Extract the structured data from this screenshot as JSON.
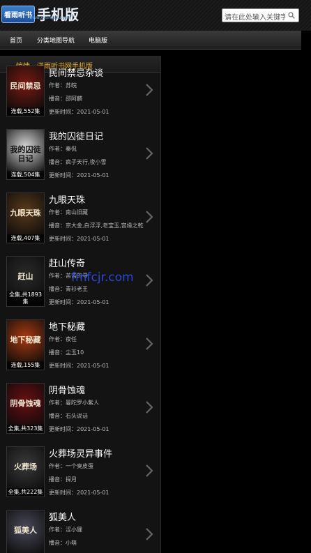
{
  "header": {
    "logo_badge": "看雨听书",
    "logo_title": "手机版",
    "logo_url": "www.xytingshu.com",
    "search_placeholder": "请在此处输入关键字"
  },
  "nav": [
    "首页",
    "分类地图导航",
    "电脑版"
  ],
  "panel": {
    "title": "惊悚 - 潇雨听书网手机版"
  },
  "labels": {
    "author": "作者：",
    "narrator": "播音：",
    "updated": "更新时间："
  },
  "items": [
    {
      "title": "民间禁忌杂谈",
      "author": "苏皖",
      "narrator": "邵阿麟",
      "updated": "2021-05-01",
      "status": "连载,552集",
      "cover_text": "民间禁忌",
      "cover_color": "#7a1a12"
    },
    {
      "title": "我的囚徒日记",
      "author": "秦侃",
      "narrator": "疯子天行,夜小雪",
      "updated": "2021-05-01",
      "status": "连载,504集",
      "cover_text": "我的囚徒日记",
      "cover_color": "#d8d8d8"
    },
    {
      "title": "九眼天珠",
      "author": "南山旧藏",
      "narrator": "京大金,白浮浮,老宝玉,宫缘之乾",
      "updated": "2021-05-01",
      "status": "连载,407集",
      "cover_text": "九眼天珠",
      "cover_color": "#5a3a1a"
    },
    {
      "title": "赶山传奇",
      "author": "苦苦的寻",
      "narrator": "青衫老王",
      "updated": "2021-05-01",
      "status": "全集,共1893集",
      "cover_text": "赶山",
      "cover_color": "#2a2a2a"
    },
    {
      "title": "地下秘藏",
      "author": "夜任",
      "narrator": "尘玉10",
      "updated": "2021-05-01",
      "status": "连载,155集",
      "cover_text": "地下秘藏",
      "cover_color": "#a83a10"
    },
    {
      "title": "阴骨蚀魂",
      "author": "曼陀罗小紫人",
      "narrator": "石头说话",
      "updated": "2021-05-01",
      "status": "全集,共323集",
      "cover_text": "阴骨蚀魂",
      "cover_color": "#6a0e12"
    },
    {
      "title": "火葬场灵异事件",
      "author": "一个臭皮蛋",
      "narrator": "探月",
      "updated": "2021-05-01",
      "status": "全集,共222集",
      "cover_text": "火葬场",
      "cover_color": "#3a3a3a"
    },
    {
      "title": "狐美人",
      "author": "涩小狸",
      "narrator": "小萌",
      "updated": "",
      "status": "",
      "cover_text": "狐美人",
      "cover_color": "#4a4a5a"
    }
  ],
  "watermark": "fmfcjr.com"
}
